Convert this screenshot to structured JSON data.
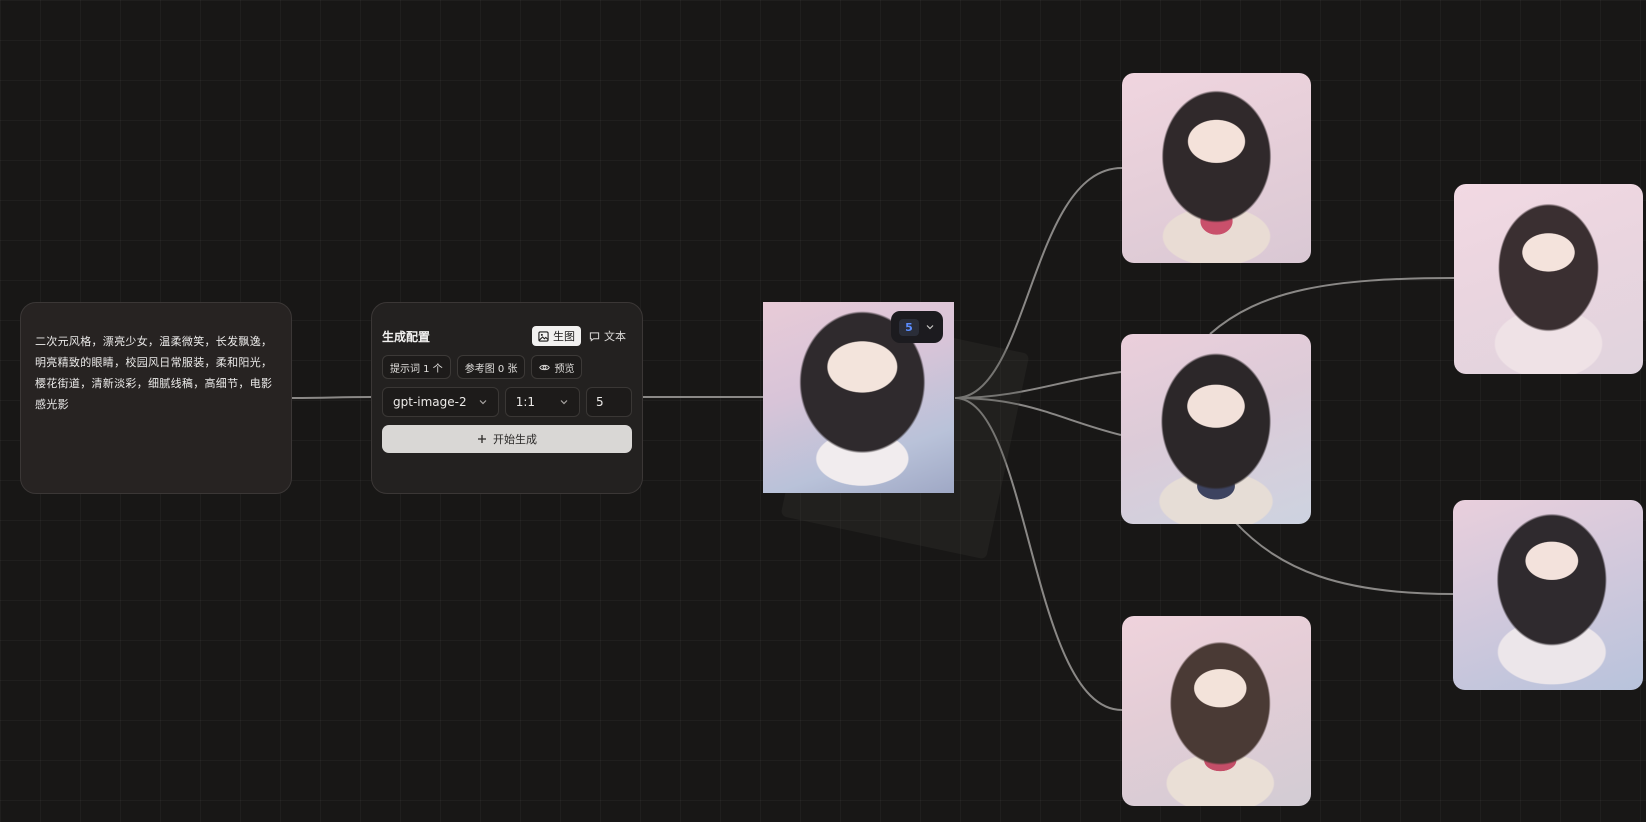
{
  "prompt_node": {
    "text": "二次元风格，漂亮少女，温柔微笑，长发飘逸，明亮精致的眼睛，校园风日常服装，柔和阳光，樱花街道，清新淡彩，细腻线稿，高细节，电影感光影"
  },
  "config_node": {
    "title": "生成配置",
    "mode_tabs": [
      {
        "label": "生图",
        "icon": "image-icon",
        "active": true
      },
      {
        "label": "文本",
        "icon": "chat-icon",
        "active": false
      }
    ],
    "chips": {
      "prompts": "提示词 1 个",
      "references": "参考图 0 张",
      "preview": "预览"
    },
    "model": "gpt-image-2",
    "ratio": "1:1",
    "count": "5",
    "generate_label": "开始生成"
  },
  "result_node": {
    "count_badge": "5"
  },
  "colors": {
    "canvas_bg": "#181716",
    "node_bg": "#272322",
    "edge": "#8a8886",
    "badge_accent": "#5b8dff"
  }
}
